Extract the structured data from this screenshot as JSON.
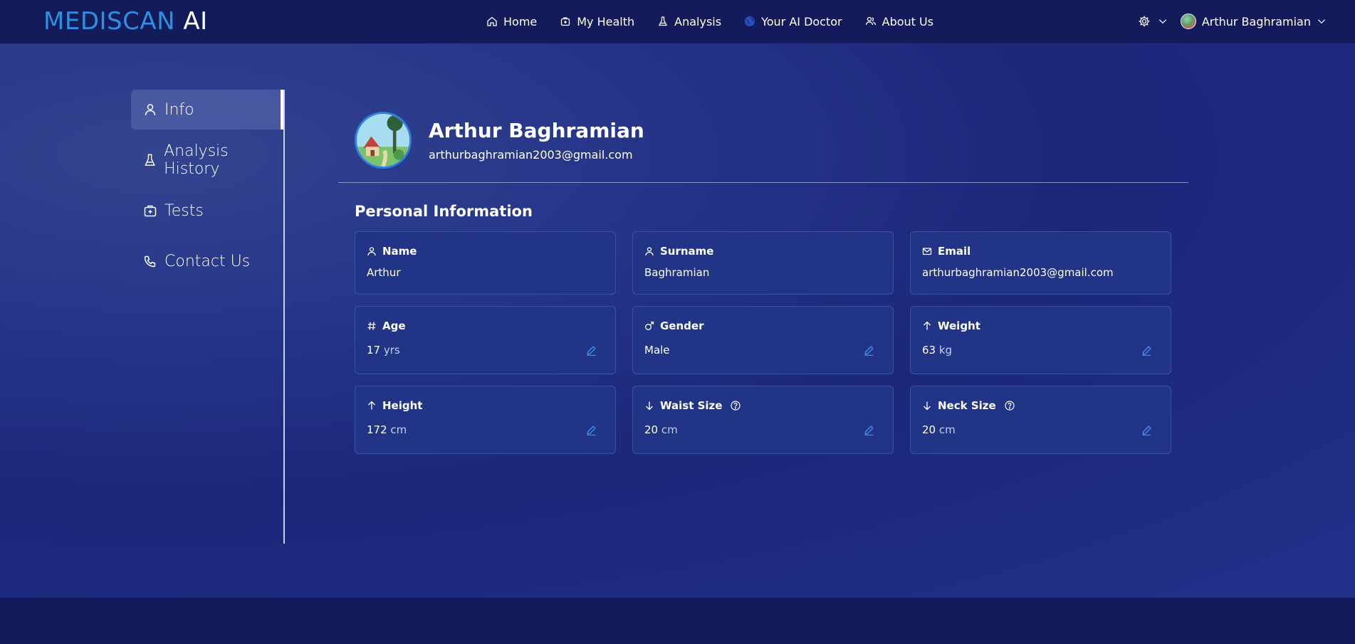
{
  "header": {
    "logo_brand": "MEDISCAN",
    "logo_ai": "AI",
    "nav": [
      {
        "label": "Home",
        "icon": "home-icon"
      },
      {
        "label": "My Health",
        "icon": "medical-bag-icon"
      },
      {
        "label": "Analysis",
        "icon": "flask-icon"
      },
      {
        "label": "Your AI Doctor",
        "icon": "globe-icon"
      },
      {
        "label": "About Us",
        "icon": "users-icon"
      }
    ],
    "user_name": "Arthur Baghramian"
  },
  "sidebar": {
    "items": [
      {
        "label": "Info",
        "icon": "user-icon",
        "active": true
      },
      {
        "label": "Analysis History",
        "icon": "flask-icon"
      },
      {
        "label": "Tests",
        "icon": "medical-kit-icon"
      },
      {
        "label": "Contact Us",
        "icon": "phone-icon"
      }
    ]
  },
  "profile": {
    "name": "Arthur Baghramian",
    "email": "arthurbaghramian2003@gmail.com"
  },
  "personal_info": {
    "title": "Personal Information",
    "fields": {
      "name": {
        "label": "Name",
        "value": "Arthur",
        "icon": "user-icon"
      },
      "surname": {
        "label": "Surname",
        "value": "Baghramian",
        "icon": "user-icon"
      },
      "email": {
        "label": "Email",
        "value": "arthurbaghramian2003@gmail.com",
        "icon": "mail-icon"
      },
      "age": {
        "label": "Age",
        "value": "17",
        "unit": "yrs",
        "icon": "hash-icon"
      },
      "gender": {
        "label": "Gender",
        "value": "Male",
        "icon": "male-icon"
      },
      "weight": {
        "label": "Weight",
        "value": "63",
        "unit": "kg",
        "icon": "arrow-up-icon"
      },
      "height": {
        "label": "Height",
        "value": "172",
        "unit": "cm",
        "icon": "arrow-up-icon"
      },
      "waist": {
        "label": "Waist Size",
        "value": "20",
        "unit": "cm",
        "icon": "arrow-down-icon"
      },
      "neck": {
        "label": "Neck Size",
        "value": "20",
        "unit": "cm",
        "icon": "arrow-down-icon"
      }
    }
  },
  "colors": {
    "brand_blue": "#2f8fe0",
    "header_bg": "#141b5a",
    "card_bg": "#223486",
    "edit_icon": "#3b8ef0"
  }
}
